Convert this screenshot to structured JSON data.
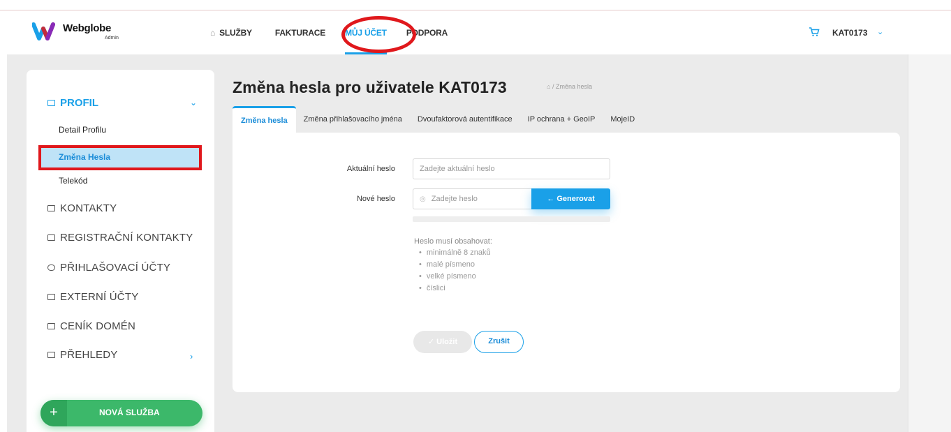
{
  "header": {
    "logo_text": "Webglobe",
    "logo_sub": "Admin",
    "nav": [
      {
        "label": "SLUŽBY",
        "icon": "home-icon"
      },
      {
        "label": "FAKTURACE"
      },
      {
        "label": "MŮJ ÚČET",
        "active": true
      },
      {
        "label": "PODPORA"
      }
    ],
    "cart_icon": "cart-icon",
    "user": "KAT0173"
  },
  "sidebar": {
    "profile_label": "PROFIL",
    "sub_items": [
      "Detail Profilu",
      "Změna Hesla",
      "Telekód"
    ],
    "items": [
      "KONTAKTY",
      "REGISTRAČNÍ KONTAKTY",
      "PŘIHLAŠOVACÍ ÚČTY",
      "EXTERNÍ ÚČTY",
      "CENÍK DOMÉN",
      "PŘEHLEDY"
    ],
    "new_button": "NOVÁ SLUŽBA"
  },
  "main": {
    "title": "Změna hesla pro uživatele KAT0173",
    "breadcrumb": "/ Změna hesla",
    "tabs": [
      "Změna hesla",
      "Změna přihlašovacího jména",
      "Dvoufaktorová autentifikace",
      "IP ochrana + GeoIP",
      "MojeID"
    ],
    "form": {
      "current_label": "Aktuální heslo",
      "current_placeholder": "Zadejte aktuální heslo",
      "new_label": "Nové heslo",
      "new_placeholder": "Zadejte heslo",
      "generate_label": "← Generovat"
    },
    "rules_title": "Heslo musí obsahovat:",
    "rules": [
      "minimálně 8 znaků",
      "malé písmeno",
      "velké písmeno",
      "číslici"
    ],
    "save_label": "✓ Uložit",
    "cancel_label": "Zrušit"
  },
  "colors": {
    "accent": "#1aa0e8",
    "annotation": "#e0181c",
    "green": "#3cb86a"
  }
}
